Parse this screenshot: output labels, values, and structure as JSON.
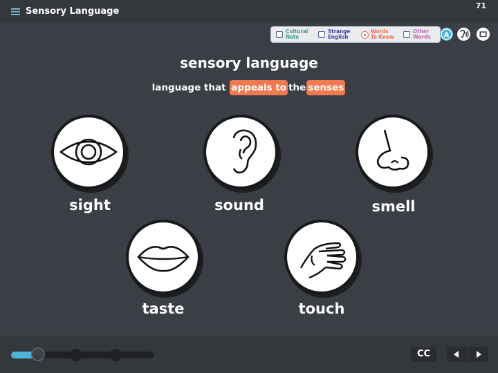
{
  "header": {
    "title": "Sensory Language",
    "page_number": "71"
  },
  "filters": [
    {
      "line1": "Cultural",
      "line2": "Note",
      "color": "#3a9b8a",
      "checked": false
    },
    {
      "line1": "Strange",
      "line2": "English",
      "color": "#3a3fa0",
      "checked": false
    },
    {
      "line1": "Words",
      "line2": "To Know",
      "color": "#ea6f50",
      "checked": true
    },
    {
      "line1": "Other",
      "line2": "Words",
      "color": "#c968b4",
      "checked": false
    }
  ],
  "toolbar_icons": [
    "accessibility-icon",
    "audio-icon",
    "fullscreen-icon"
  ],
  "lesson": {
    "title": "sensory language",
    "definition": {
      "before": "language that",
      "highlight1": "appeals to",
      "middle": "the",
      "highlight2": "senses"
    }
  },
  "senses": [
    {
      "label": "sight",
      "icon": "eye-icon"
    },
    {
      "label": "sound",
      "icon": "ear-icon"
    },
    {
      "label": "smell",
      "icon": "nose-icon"
    },
    {
      "label": "taste",
      "icon": "lips-icon"
    },
    {
      "label": "touch",
      "icon": "hand-icon"
    }
  ],
  "player": {
    "progress": 0.19,
    "cc_label": "CC",
    "prev_icon": "previous-icon",
    "next_icon": "next-icon"
  }
}
